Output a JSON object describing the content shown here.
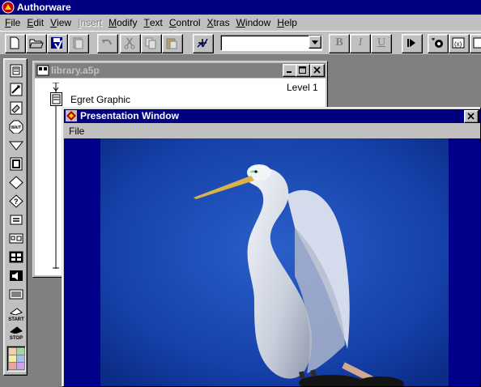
{
  "app": {
    "title": "Authorware",
    "menu": [
      {
        "label": "File",
        "underline": "F",
        "rest": "ile",
        "enabled": true
      },
      {
        "label": "Edit",
        "underline": "E",
        "rest": "dit",
        "enabled": true
      },
      {
        "label": "View",
        "underline": "V",
        "rest": "iew",
        "enabled": true
      },
      {
        "label": "Insert",
        "underline": "I",
        "rest": "nsert",
        "enabled": false
      },
      {
        "label": "Modify",
        "underline": "M",
        "rest": "odify",
        "enabled": true
      },
      {
        "label": "Text",
        "underline": "T",
        "rest": "ext",
        "enabled": true
      },
      {
        "label": "Control",
        "underline": "C",
        "rest": "ontrol",
        "enabled": true
      },
      {
        "label": "Xtras",
        "underline": "X",
        "rest": "tras",
        "enabled": true
      },
      {
        "label": "Window",
        "underline": "W",
        "rest": "indow",
        "enabled": true
      },
      {
        "label": "Help",
        "underline": "H",
        "rest": "elp",
        "enabled": true
      }
    ]
  },
  "toolbar": {
    "buttons": [
      "new-icon",
      "open-icon",
      "save-all-icon",
      "import-icon",
      "undo-icon",
      "cut-icon",
      "copy-icon",
      "paste-icon",
      "find-icon"
    ],
    "style_dropdown_value": "",
    "format": {
      "bold": "B",
      "italic": "I",
      "underline": "U"
    },
    "right_buttons": [
      "restart-icon",
      "control-panel-icon",
      "functions-icon",
      "variables-icon"
    ]
  },
  "icon_palette": {
    "icons": [
      "display-icon",
      "animation-icon",
      "erase-icon",
      "wait-icon",
      "navigate-icon",
      "framework-icon",
      "decision-icon",
      "interaction-icon",
      "calculation-icon",
      "map-icon",
      "digital-movie-icon",
      "sound-icon",
      "video-icon"
    ],
    "wait_label": "WAIT",
    "start_label": "START",
    "stop_label": "STOP",
    "swatch_colors": [
      "#f0d0a0",
      "#a0d8a0",
      "#f0f0a0",
      "#a0c0f0",
      "#f0a0a0",
      "#d0a0f0"
    ]
  },
  "library_window": {
    "title": "library.a5p",
    "level_label": "Level 1",
    "item_label": "Egret Graphic"
  },
  "presentation_window": {
    "title": "Presentation Window",
    "menu_file": "File",
    "background_color": "#00008b"
  }
}
